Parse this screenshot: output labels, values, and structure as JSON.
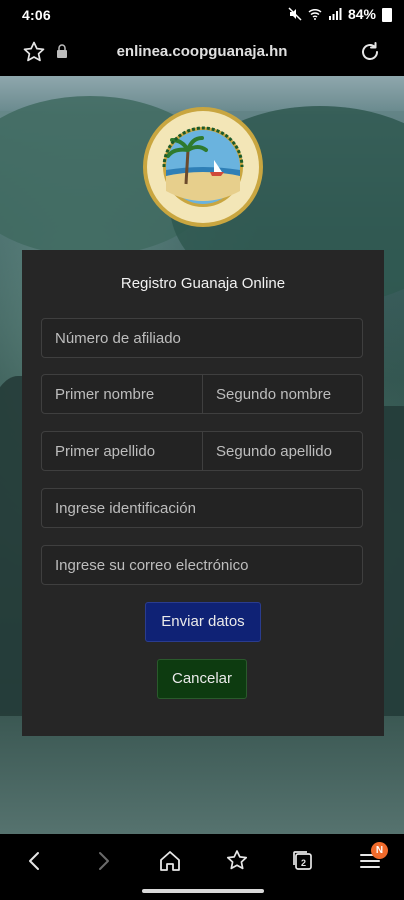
{
  "status_bar": {
    "time": "4:06",
    "battery": "84%"
  },
  "browser": {
    "url": "enlinea.coopguanaja.hn"
  },
  "form": {
    "title": "Registro Guanaja Online",
    "fields": {
      "afiliado": "Número de afiliado",
      "primer_nombre": "Primer nombre",
      "segundo_nombre": "Segundo nombre",
      "primer_apellido": "Primer apellido",
      "segundo_apellido": "Segundo apellido",
      "identificacion": "Ingrese identificación",
      "correo": "Ingrese su correo electrónico"
    },
    "buttons": {
      "enviar": "Enviar datos",
      "cancelar": "Cancelar"
    },
    "colors": {
      "enviar": "#0f2275",
      "cancelar": "#0d3b10",
      "panel": "#262626"
    }
  },
  "nav": {
    "badge": "N"
  },
  "icons": [
    "star-icon",
    "lock-icon",
    "reload-icon",
    "back-icon",
    "forward-icon",
    "home-icon",
    "bookmarks-icon",
    "tabs-icon",
    "menu-icon"
  ]
}
